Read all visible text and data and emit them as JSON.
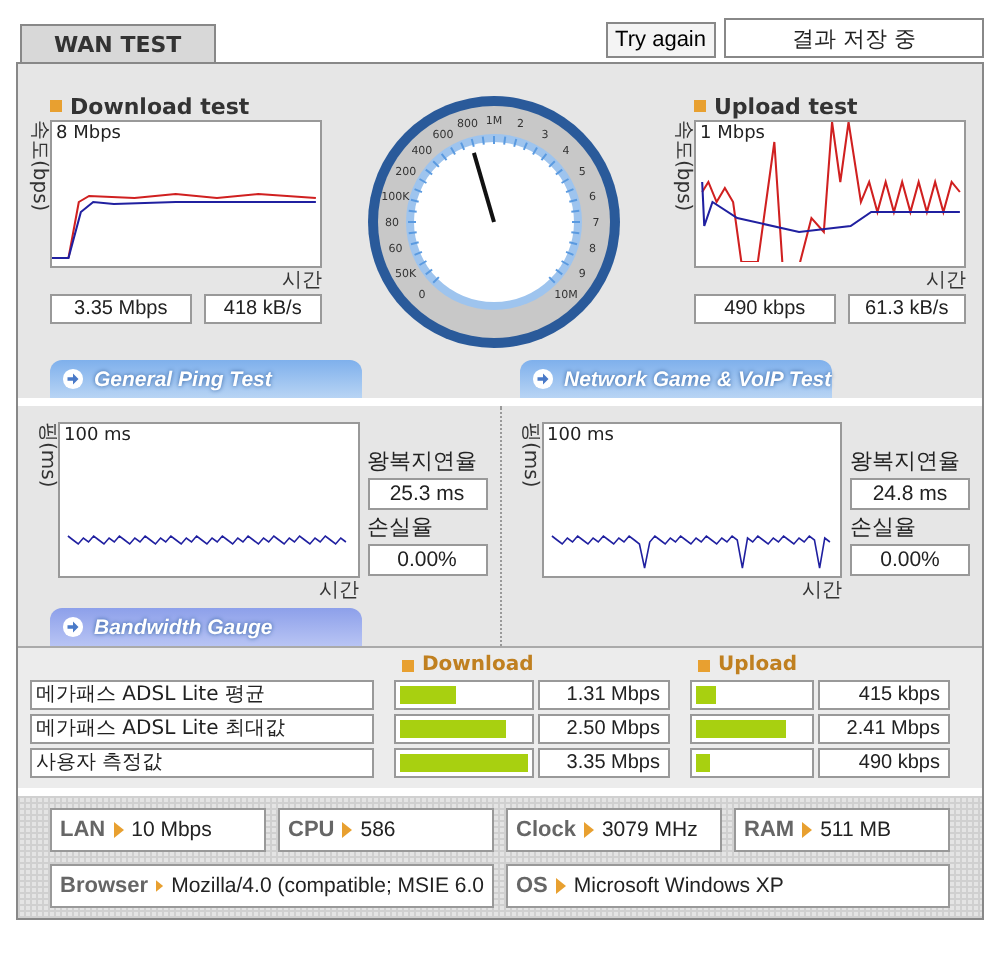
{
  "header": {
    "tab": "WAN TEST",
    "button": "Try again",
    "status": "결과 저장 중"
  },
  "download": {
    "title": "Download test",
    "ylabel": "속도(bps)",
    "scale": "8 Mbps",
    "xlabel": "시간",
    "readings": [
      "3.35 Mbps",
      "418 kB/s"
    ]
  },
  "gauge": {
    "labels": [
      "800",
      "1M",
      "2",
      "600",
      "3",
      "400",
      "4",
      "200",
      "5",
      "100K",
      "6",
      "80",
      "7",
      "60",
      "8",
      "50K",
      "9",
      "0",
      "10M"
    ]
  },
  "upload": {
    "title": "Upload test",
    "ylabel": "속도(bps)",
    "scale": "1 Mbps",
    "xlabel": "시간",
    "readings": [
      "490 kbps",
      "61.3 kB/s"
    ]
  },
  "ping_tabs": [
    "General Ping Test",
    "Network Game & VoIP Test"
  ],
  "ping_panels": [
    {
      "ylabel": "핑(ms)",
      "scale": "100 ms",
      "xlabel": "시간",
      "latency_label": "왕복지연율",
      "latency": "25.3 ms",
      "loss_label": "손실율",
      "loss": "0.00%"
    },
    {
      "ylabel": "핑(ms)",
      "scale": "100 ms",
      "xlabel": "시간",
      "latency_label": "왕복지연율",
      "latency": "24.8 ms",
      "loss_label": "손실율",
      "loss": "0.00%"
    }
  ],
  "bandwidth": {
    "tab": "Bandwidth Gauge",
    "download_header": "Download",
    "upload_header": "Upload",
    "rows": [
      {
        "label": "메가패스 ADSL Lite 평균",
        "download": {
          "level": 0.43,
          "value": "1.31 Mbps"
        },
        "upload": {
          "level": 0.17,
          "value": "415 kbps"
        }
      },
      {
        "label": "메가패스 ADSL Lite 최대값",
        "download": {
          "level": 0.83,
          "value": "2.50 Mbps"
        },
        "upload": {
          "level": 0.8,
          "value": "2.41 Mbps"
        }
      },
      {
        "label": "사용자 측정값",
        "download": {
          "level": 1,
          "value": "3.35 Mbps"
        },
        "upload": {
          "level": 0.12,
          "value": "490 kbps"
        }
      }
    ]
  },
  "system_info": [
    [
      {
        "label": "LAN",
        "value": "10 Mbps"
      },
      {
        "label": "CPU",
        "value": "586"
      },
      {
        "label": "Clock",
        "value": "3079 MHz"
      },
      {
        "label": "RAM",
        "value": "511 MB"
      }
    ],
    [
      {
        "label": "Browser",
        "value": "Mozilla/4.0 (compatible; MSIE 6.0"
      },
      {
        "label": "OS",
        "value": "Microsoft Windows XP"
      }
    ]
  ]
}
